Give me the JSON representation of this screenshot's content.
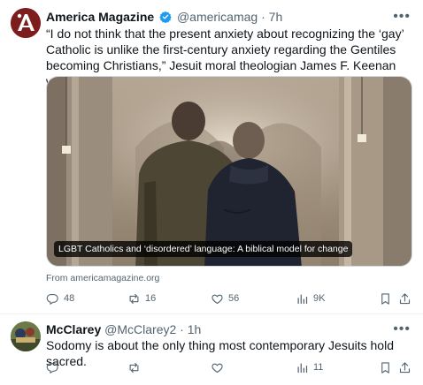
{
  "tweets": [
    {
      "author_name": "America Magazine",
      "handle": "@americamag",
      "time": "7h",
      "verified": true,
      "text": "“I do not think that the present anxiety about recognizing the ‘gay’ Catholic is unlike the first-century anxiety regarding the Gentiles becoming Christians,” Jesuit moral theologian James F. Keenan writes.",
      "card_title": "LGBT Catholics and ‘disordered’ language: A biblical model for change",
      "card_source": "From americamagazine.org",
      "stats": {
        "replies": "48",
        "reposts": "16",
        "likes": "56",
        "views": "9K"
      }
    },
    {
      "author_name": "McClarey",
      "handle": "@McClarey2",
      "time": "1h",
      "verified": false,
      "text": "Sodomy is about the only thing most contemporary Jesuits hold sacred.",
      "stats": {
        "replies": "",
        "reposts": "",
        "likes": "",
        "views": "11"
      }
    }
  ],
  "icons": {
    "verified": "verified-badge-icon",
    "reply": "reply-icon",
    "repost": "repost-icon",
    "like": "like-icon",
    "views": "views-icon",
    "bookmark": "bookmark-icon",
    "share": "share-icon",
    "more": "more-icon"
  },
  "colors": {
    "verified": "#1d9bf0",
    "muted": "#536471",
    "avatar1": "#8b1a1a"
  }
}
